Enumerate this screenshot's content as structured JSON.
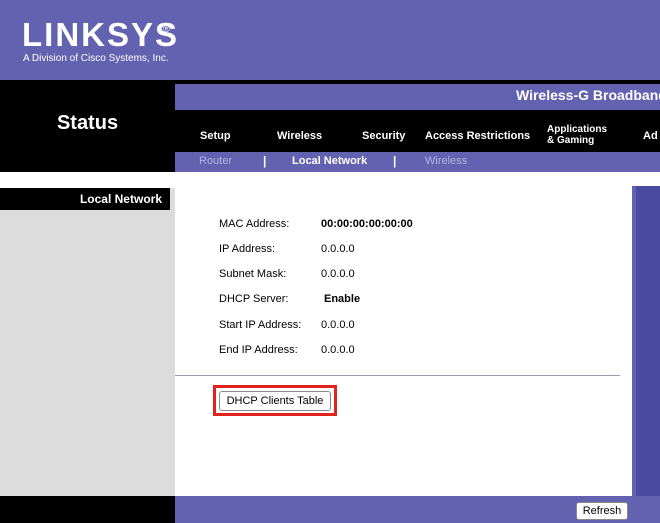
{
  "brand": {
    "logo_text": "LINKSYS",
    "registered_mark": "®",
    "subtitle": "A Division of Cisco Systems, Inc."
  },
  "product": {
    "name": "Wireless-G Broadband"
  },
  "page": {
    "title": "Status"
  },
  "tabs": {
    "setup": "Setup",
    "wireless": "Wireless",
    "security": "Security",
    "access_restrictions": "Access Restrictions",
    "apps_line1": "Applications",
    "apps_line2": "& Gaming",
    "admin_partial": "Ad"
  },
  "subnav": {
    "router": "Router",
    "local_network": "Local Network",
    "wireless": "Wireless",
    "separator": "|"
  },
  "section": {
    "label": "Local Network"
  },
  "fields": {
    "mac_label": "MAC Address:",
    "mac_value": "00:00:00:00:00:00",
    "ip_label": "IP Address:",
    "ip_value": "0.0.0.0",
    "subnet_label": "Subnet Mask:",
    "subnet_value": "0.0.0.0",
    "dhcp_label": "DHCP Server:",
    "dhcp_value": "Enable",
    "start_ip_label": "Start IP Address:",
    "start_ip_value": "0.0.0.0",
    "end_ip_label": "End IP Address:",
    "end_ip_value": "0.0.0.0"
  },
  "buttons": {
    "dhcp_clients_table": "DHCP Clients Table",
    "refresh": "Refresh"
  },
  "colors": {
    "brand_purple": "#6262b1",
    "highlight_red": "#e2221c",
    "inactive_subnav": "#b4b4dc"
  }
}
